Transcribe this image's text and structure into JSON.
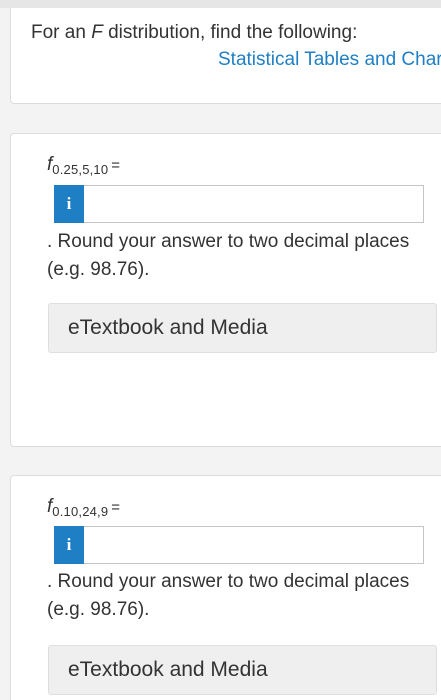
{
  "intro": {
    "text_before": "For an ",
    "variable": "F",
    "text_after": " distribution, find the following:",
    "link_label": "Statistical Tables and Charts"
  },
  "questions": [
    {
      "symbol": "f",
      "subscript": "0.25,5,10",
      "equals": "=",
      "answer_value": "",
      "info_icon": "i",
      "hint": ". Round your answer to two decimal places (e.g. 98.76).",
      "media_label": "eTextbook and Media"
    },
    {
      "symbol": "f",
      "subscript": "0.10,24,9",
      "equals": "=",
      "answer_value": "",
      "info_icon": "i",
      "hint": ". Round your answer to two decimal places (e.g. 98.76).",
      "media_label": "eTextbook and Media"
    }
  ],
  "colors": {
    "accent": "#1f7fc4",
    "text": "#333333",
    "card_bg": "#ffffff",
    "page_bg": "#f3f3f3",
    "button_bg": "#efefef"
  }
}
